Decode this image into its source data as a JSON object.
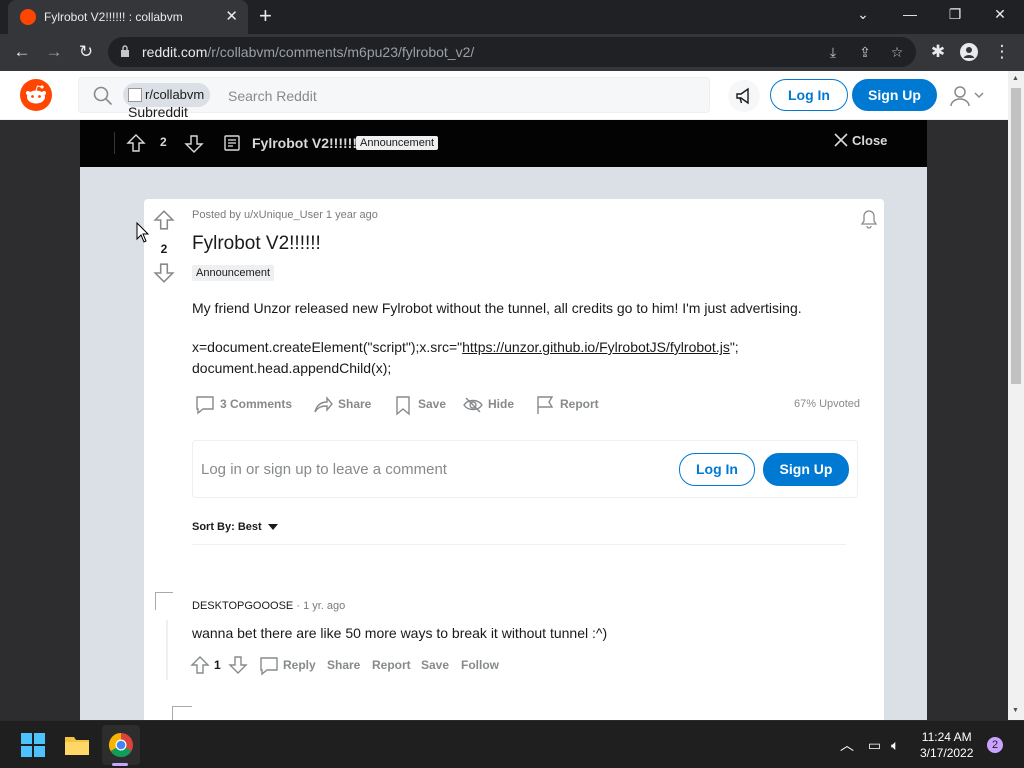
{
  "browser": {
    "tab_title": "Fylrobot V2!!!!!! : collabvm",
    "url_host": "reddit.com",
    "url_path": "/r/collabvm/comments/m6pu23/fylrobot_v2/"
  },
  "header": {
    "chip_label": "r/collabvm",
    "search_placeholder": "Search Reddit",
    "subreddit_alt": "Subreddit",
    "login_label": "Log In",
    "signup_label": "Sign Up"
  },
  "modal_bar": {
    "vote_count": "2",
    "title": "Fylrobot V2!!!!!!",
    "flair": "Announcement",
    "close_label": "Close"
  },
  "post": {
    "vote_count": "2",
    "meta": "Posted by u/xUnique_User 1 year ago",
    "title": "Fylrobot V2!!!!!!",
    "flair": "Announcement",
    "body_line1": "My friend Unzor released new Fylrobot without the tunnel, all credits go to him! I'm just advertising.",
    "body_code_prefix": "x=document.createElement(\"script\");x.src=\"",
    "body_link": "https://unzor.github.io/FylrobotJS/fylrobot.js",
    "body_code_suffix": "\";",
    "body_code_line2": "document.head.appendChild(x);",
    "comments_label": "3 Comments",
    "share_label": "Share",
    "save_label": "Save",
    "hide_label": "Hide",
    "report_label": "Report",
    "upvoted": "67% Upvoted",
    "comment_placeholder": "Log in or sign up to leave a comment",
    "login_label": "Log In",
    "signup_label": "Sign Up",
    "sort_label": "Sort By: Best"
  },
  "comment": {
    "user": "DESKTOPGOOOSE",
    "time": "· 1 yr. ago",
    "text": "wanna bet there are like 50 more ways to break it without tunnel :^)",
    "votes": "1",
    "reply_label": "Reply",
    "share_label": "Share",
    "report_label": "Report",
    "save_label": "Save",
    "follow_label": "Follow"
  },
  "taskbar": {
    "time": "11:24 AM",
    "date": "3/17/2022",
    "notif_count": "2"
  },
  "colors": {
    "reddit_orange": "#ff4500",
    "reddit_blue": "#0079d3"
  }
}
